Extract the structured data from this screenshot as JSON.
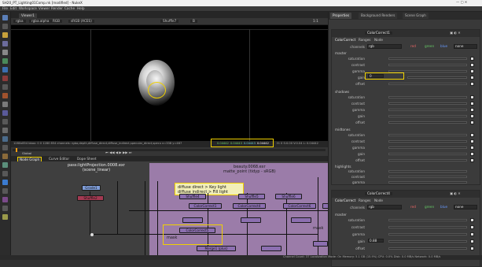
{
  "window_title": "SH20_PT_Lighting01Comp.nk [modified] - NukeX",
  "menu": [
    "File",
    "Edit",
    "Workspace",
    "Viewer",
    "Render",
    "Cache",
    "Help"
  ],
  "viewer": {
    "tab": "Viewer1",
    "controls": {
      "channels": "rgba",
      "alpha": "rgba.alpha",
      "rgb": "RGB",
      "colorspace": "sRGB (ACES)",
      "input_a": "Shuffle7",
      "input_b": "B",
      "zoom": "1:1"
    },
    "info_left": "1280x854  bbox: 0 0 1280 854 channels: rgba,depth,diffuse_direct,diffuse_indirect,specular_direct,specu x=338 y=467",
    "info_values": [
      "0.04442",
      "0.04443",
      "0.04443",
      "0.04442"
    ],
    "info_hsvl": "H: 0 S:0.00 V:0.04 L: 0.04442",
    "timeline_label": "Global"
  },
  "node_graph": {
    "tabs": [
      "Node Graph",
      "Curve Editor",
      "Dope Sheet"
    ],
    "annotations": {
      "projection": "pass:lightProjection.0008.exr\n(scene_linear)",
      "beauty": "beauty.0068.exr\nmatte_point (tidyp - sRGB)",
      "diffuse": "diffuse direct > Key light\ndiffuse indirect > Fill light",
      "mask": "mask"
    },
    "nodes": {
      "grade": "Grade1",
      "shuffle_red": "Shuffle2",
      "cc1": "ColorCorrect1",
      "cc2": "ColorCorrect4",
      "cc3": "ColorCorrect6",
      "cc5": "ColorCorrect5",
      "shuffle4": "Shuffle4",
      "shuffle5": "Shuffle5",
      "shuffle6": "Shuffle6",
      "merge": "Merge1 (plus)"
    }
  },
  "properties": {
    "tabs": [
      "Properties",
      "Background Renders",
      "Scene Graph"
    ],
    "panel1": {
      "name": "ColorCorrect1",
      "subtabs": [
        "ColorCorrect",
        "Ranges",
        "Node"
      ],
      "channels_label": "channels",
      "channels_value": "rgb",
      "checks": [
        "red",
        "green",
        "blue"
      ],
      "none": "none",
      "sections": [
        {
          "title": "master",
          "rows": [
            "saturation",
            "contrast",
            "gamma",
            "gain",
            "offset"
          ]
        },
        {
          "title": "shadows",
          "rows": [
            "saturation",
            "contrast",
            "gamma",
            "gain",
            "offset"
          ]
        },
        {
          "title": "midtones",
          "rows": [
            "saturation",
            "contrast",
            "gamma",
            "gain",
            "offset"
          ]
        },
        {
          "title": "highlights",
          "rows": [
            "saturation",
            "contrast",
            "gamma",
            "gain",
            "offset"
          ]
        }
      ],
      "gain_value": "0"
    },
    "panel2": {
      "name": "ColorCorrect4",
      "subtabs": [
        "ColorCorrect",
        "Ranges",
        "Node"
      ],
      "channels_label": "channels",
      "channels_value": "rgb",
      "checks": [
        "red",
        "green",
        "blue"
      ],
      "none": "none",
      "sections": [
        {
          "title": "master",
          "rows": [
            "saturation",
            "contrast",
            "gamma",
            "gain",
            "offset"
          ]
        }
      ],
      "gain_value": "0.88"
    }
  },
  "status": "Channel Count: 37  Localization Mode: On  Memory: 5.1 GB (15.9%)  CPU: 0.0%  Disk: 0.0 MB/s  Network: 0.0 MB/s",
  "colors": {
    "highlight": "#f0d000",
    "purple_node": "#8c6fb0",
    "blue_node": "#7f9dd8",
    "red_node": "#a33a52"
  }
}
